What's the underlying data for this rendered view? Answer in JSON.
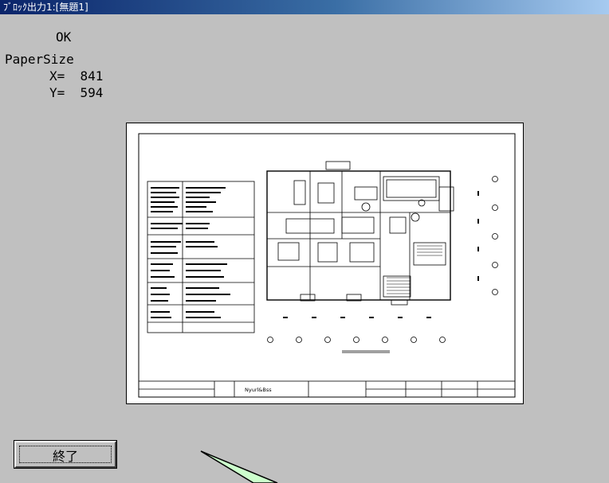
{
  "window": {
    "title": "ﾌﾞﾛｯｸ出力1:[無題1]"
  },
  "status": {
    "text": "OK"
  },
  "paper": {
    "label": "PaperSize",
    "x_line": "X=  841",
    "y_line": "Y=  594"
  },
  "preview": {
    "title_block_text": "Nyurl&Bss"
  },
  "buttons": {
    "end_label": "終了"
  },
  "colors": {
    "background": "#c0c0c0",
    "callout": "#ccffcc"
  }
}
